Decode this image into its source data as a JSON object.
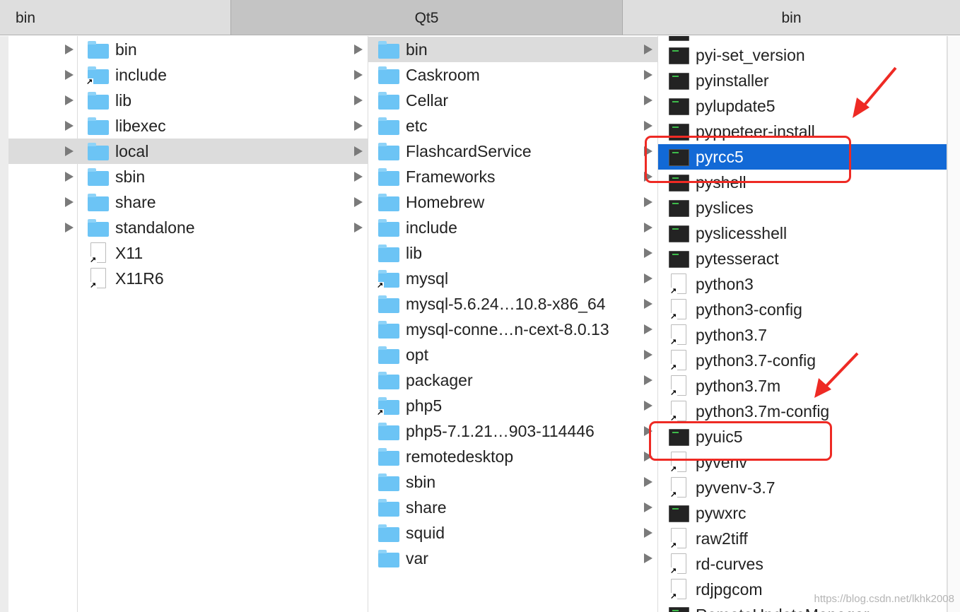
{
  "tabs": [
    {
      "label": "bin"
    },
    {
      "label": "Qt5"
    },
    {
      "label": "bin"
    }
  ],
  "columns": [
    {
      "items": [
        {
          "label": "bin",
          "kind": "folder",
          "arrow": true
        },
        {
          "label": "include",
          "kind": "folder",
          "alias": true,
          "arrow": true
        },
        {
          "label": "lib",
          "kind": "folder",
          "arrow": true
        },
        {
          "label": "libexec",
          "kind": "folder",
          "arrow": true
        },
        {
          "label": "local",
          "kind": "folder",
          "arrow": true,
          "selected": true
        },
        {
          "label": "sbin",
          "kind": "folder",
          "arrow": true
        },
        {
          "label": "share",
          "kind": "folder",
          "arrow": true
        },
        {
          "label": "standalone",
          "kind": "folder",
          "arrow": true
        },
        {
          "label": "X11",
          "kind": "doc",
          "alias": true
        },
        {
          "label": "X11R6",
          "kind": "doc",
          "alias": true
        }
      ]
    },
    {
      "items": [
        {
          "label": "bin",
          "kind": "folder",
          "arrow": true,
          "selected": true
        },
        {
          "label": "Caskroom",
          "kind": "folder",
          "arrow": true
        },
        {
          "label": "Cellar",
          "kind": "folder",
          "arrow": true
        },
        {
          "label": "etc",
          "kind": "folder",
          "arrow": true
        },
        {
          "label": "FlashcardService",
          "kind": "folder",
          "arrow": true
        },
        {
          "label": "Frameworks",
          "kind": "folder",
          "arrow": true
        },
        {
          "label": "Homebrew",
          "kind": "folder",
          "arrow": true
        },
        {
          "label": "include",
          "kind": "folder",
          "arrow": true
        },
        {
          "label": "lib",
          "kind": "folder",
          "arrow": true
        },
        {
          "label": "mysql",
          "kind": "folder",
          "alias": true,
          "arrow": true
        },
        {
          "label": "mysql-5.6.24…10.8-x86_64",
          "kind": "folder",
          "arrow": true
        },
        {
          "label": "mysql-conne…n-cext-8.0.13",
          "kind": "folder",
          "arrow": true
        },
        {
          "label": "opt",
          "kind": "folder",
          "arrow": true
        },
        {
          "label": "packager",
          "kind": "folder",
          "arrow": true
        },
        {
          "label": "php5",
          "kind": "folder",
          "alias": true,
          "arrow": true
        },
        {
          "label": "php5-7.1.21…903-114446",
          "kind": "folder",
          "arrow": true
        },
        {
          "label": "remotedesktop",
          "kind": "folder",
          "arrow": true
        },
        {
          "label": "sbin",
          "kind": "folder",
          "arrow": true
        },
        {
          "label": "share",
          "kind": "folder",
          "arrow": true
        },
        {
          "label": "squid",
          "kind": "folder",
          "arrow": true
        },
        {
          "label": "var",
          "kind": "folder",
          "arrow": true
        }
      ]
    },
    {
      "items": [
        {
          "label": "pyi-set_version",
          "kind": "exec"
        },
        {
          "label": "pyinstaller",
          "kind": "exec"
        },
        {
          "label": "pylupdate5",
          "kind": "exec"
        },
        {
          "label": "pyppeteer-install",
          "kind": "exec"
        },
        {
          "label": "pyrcc5",
          "kind": "exec",
          "highlighted": true
        },
        {
          "label": "pyshell",
          "kind": "exec"
        },
        {
          "label": "pyslices",
          "kind": "exec"
        },
        {
          "label": "pyslicesshell",
          "kind": "exec"
        },
        {
          "label": "pytesseract",
          "kind": "exec"
        },
        {
          "label": "python3",
          "kind": "doc",
          "alias": true
        },
        {
          "label": "python3-config",
          "kind": "doc",
          "alias": true
        },
        {
          "label": "python3.7",
          "kind": "doc",
          "alias": true
        },
        {
          "label": "python3.7-config",
          "kind": "doc",
          "alias": true
        },
        {
          "label": "python3.7m",
          "kind": "doc",
          "alias": true
        },
        {
          "label": "python3.7m-config",
          "kind": "doc",
          "alias": true
        },
        {
          "label": "pyuic5",
          "kind": "exec"
        },
        {
          "label": "pyvenv",
          "kind": "doc",
          "alias": true
        },
        {
          "label": "pyvenv-3.7",
          "kind": "doc",
          "alias": true
        },
        {
          "label": "pywxrc",
          "kind": "exec"
        },
        {
          "label": "raw2tiff",
          "kind": "doc",
          "alias": true
        },
        {
          "label": "rd-curves",
          "kind": "doc",
          "alias": true
        },
        {
          "label": "rdjpgcom",
          "kind": "doc",
          "alias": true
        },
        {
          "label": "RemoteUpdateManager",
          "kind": "exec"
        }
      ]
    }
  ],
  "annotation_color": "#ee2a24",
  "selection_color": "#1269d6",
  "watermark": "https://blog.csdn.net/lkhk2008"
}
